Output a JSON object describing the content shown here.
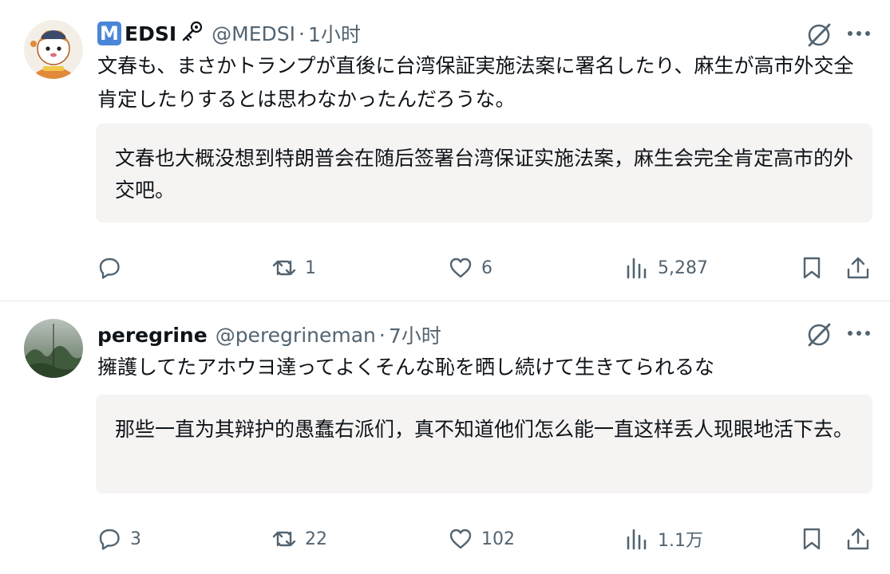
{
  "posts": [
    {
      "name": "EDSI",
      "name_badge": "M",
      "handle": "@MEDSI",
      "time": "1小时",
      "text": "文春も、まさかトランプが直後に台湾保証実施法案に署名したり、麻生が高市外交全肯定したりするとは思わなかったんだろうな。",
      "translation": "文春也大概没想到特朗普会在随后签署台湾保证实施法案，麻生会完全肯定高市的外交吧。",
      "replies": "",
      "retweets": "1",
      "likes": "6",
      "views": "5,287"
    },
    {
      "name": "peregrine",
      "handle": "@peregrineman",
      "time": "7小时",
      "text": "擁護してたアホウヨ達ってよくそんな恥を晒し続けて生きてられるな",
      "translation": "那些一直为其辩护的愚蠢右派们，真不知道他们怎么能一直这样丢人现眼地活下去。",
      "replies": "3",
      "retweets": "22",
      "likes": "102",
      "views": "1.1万"
    }
  ],
  "colors": {
    "text": "#0f1419",
    "secondary": "#536471",
    "translation_bg": "#f6f3f3",
    "badge": "#4a86d8"
  },
  "icons": [
    "reply-icon",
    "retweet-icon",
    "like-icon",
    "views-icon",
    "bookmark-icon",
    "share-icon",
    "grok-icon",
    "more-icon",
    "key-icon"
  ]
}
